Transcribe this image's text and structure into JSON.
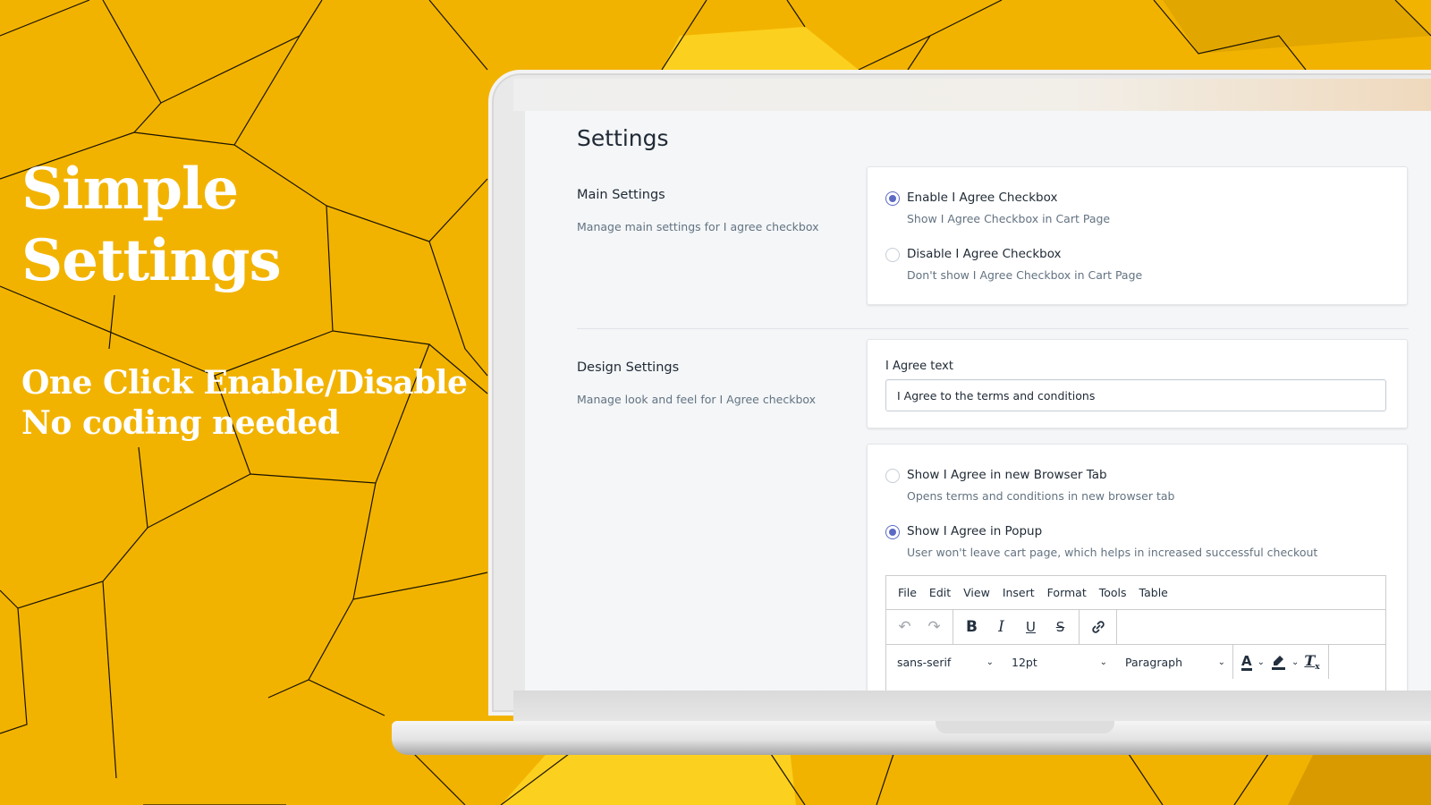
{
  "promo": {
    "title_line1": "Simple",
    "title_line2": "Settings",
    "sub_line1": "One Click Enable/Disable",
    "sub_line2": "No coding needed"
  },
  "colors": {
    "background": "#f2b300",
    "accent": "#5c6ac4",
    "text": "#212b36",
    "subdued_text": "#637381"
  },
  "settings": {
    "page_title": "Settings",
    "main": {
      "heading": "Main Settings",
      "description": "Manage main settings for I agree checkbox",
      "options": [
        {
          "label": "Enable I Agree Checkbox",
          "help": "Show I Agree Checkbox in Cart Page",
          "checked": true
        },
        {
          "label": "Disable I Agree Checkbox",
          "help": "Don't show I Agree Checkbox in Cart Page",
          "checked": false
        }
      ]
    },
    "design": {
      "heading": "Design Settings",
      "description": "Manage look and feel for I Agree checkbox",
      "text_field": {
        "label": "I Agree text",
        "value": "I Agree to the terms and conditions"
      },
      "display_options": [
        {
          "label": "Show I Agree in new Browser Tab",
          "help": "Opens terms and conditions in new browser tab",
          "checked": false
        },
        {
          "label": "Show I Agree in Popup",
          "help": "User won't leave cart page, which helps in increased successful checkout",
          "checked": true
        }
      ]
    },
    "editor": {
      "menu": [
        "File",
        "Edit",
        "View",
        "Insert",
        "Format",
        "Tools",
        "Table"
      ],
      "toolbar_icons": {
        "undo": "↶",
        "redo": "↷",
        "bold": "B",
        "italic": "I",
        "underline": "U",
        "strikethrough": "S",
        "link": "🔗"
      },
      "font_family": "sans-serif",
      "font_size": "12pt",
      "block_format": "Paragraph",
      "text_color_glyph": "A",
      "highlight_glyph": "✎",
      "clear_format_glyph": "T",
      "chevron": "⌄"
    }
  }
}
